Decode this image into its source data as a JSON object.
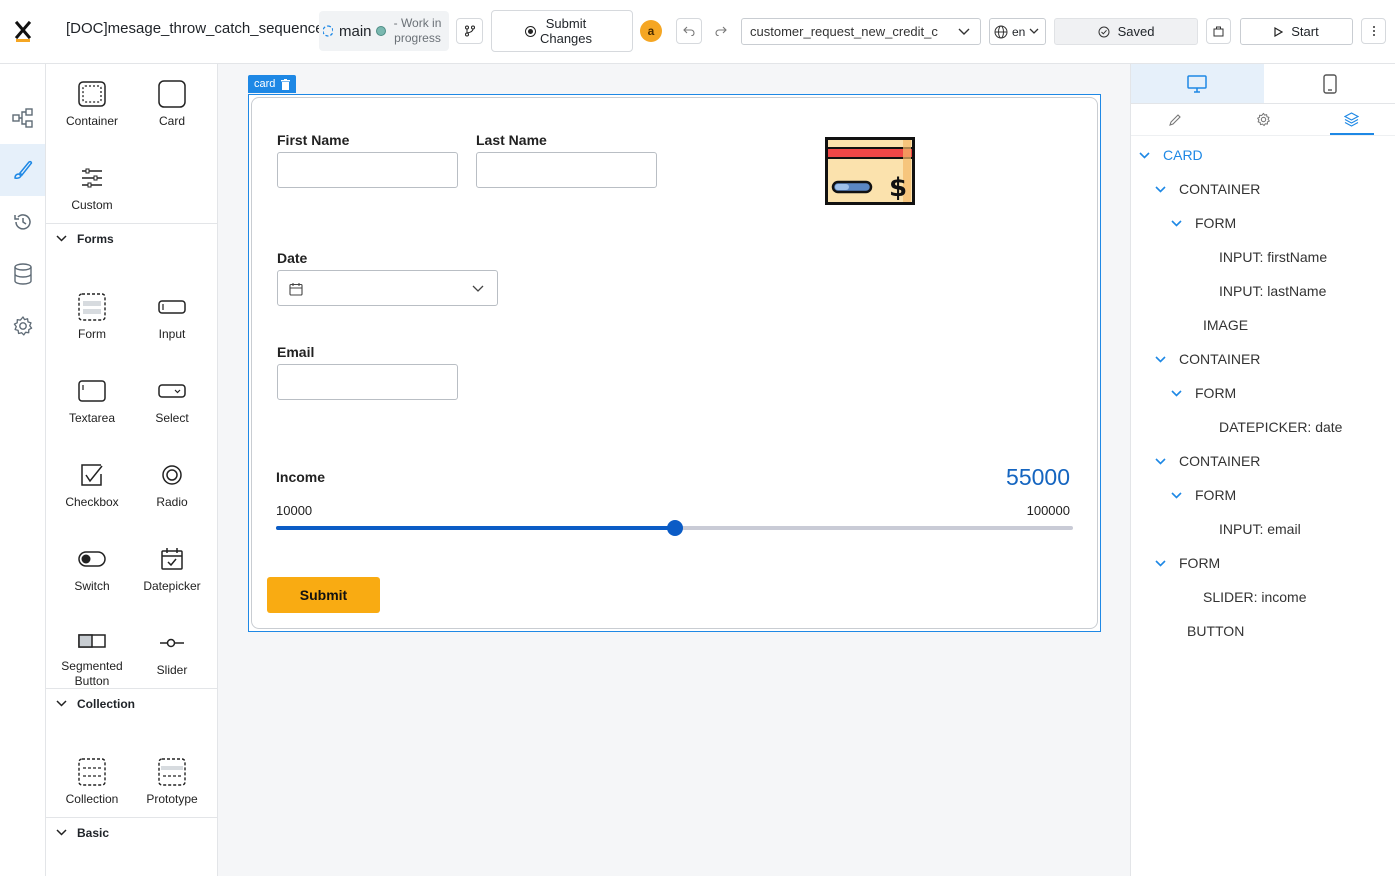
{
  "header": {
    "logo_letter": "x",
    "process_title": "[DOC]mesage_throw_catch_sequence",
    "branch_name": "main",
    "branch_status": "- Work in progress",
    "submit_changes_label": "Submit Changes",
    "user_initial": "a",
    "datasource": "customer_request_new_credit_c",
    "language": "en",
    "saved_label": "Saved",
    "start_label": "Start"
  },
  "rail": {
    "items": [
      "process-icon",
      "brush-icon",
      "history-icon",
      "database-icon",
      "settings-icon"
    ],
    "active": "brush-icon"
  },
  "palette": {
    "top_items": [
      {
        "label": "Container",
        "icon": "container-icon"
      },
      {
        "label": "Card",
        "icon": "card-icon"
      },
      {
        "label": "Custom",
        "icon": "custom-icon"
      }
    ],
    "forms_title": "Forms",
    "forms_items": [
      {
        "label": "Form",
        "icon": "form-icon"
      },
      {
        "label": "Input",
        "icon": "input-icon"
      },
      {
        "label": "Textarea",
        "icon": "textarea-icon"
      },
      {
        "label": "Select",
        "icon": "select-icon"
      },
      {
        "label": "Checkbox",
        "icon": "checkbox-icon"
      },
      {
        "label": "Radio",
        "icon": "radio-icon"
      },
      {
        "label": "Switch",
        "icon": "switch-icon"
      },
      {
        "label": "Datepicker",
        "icon": "datepicker-icon"
      },
      {
        "label": "Segmented Button",
        "icon": "segmented-button-icon"
      },
      {
        "label": "Slider",
        "icon": "slider-icon"
      }
    ],
    "collection_title": "Collection",
    "collection_items": [
      {
        "label": "Collection",
        "icon": "collection-icon"
      },
      {
        "label": "Prototype",
        "icon": "prototype-icon"
      }
    ],
    "basic_title": "Basic"
  },
  "canvas": {
    "card_tag": "card",
    "first_name_label": "First Name",
    "first_name_value": "",
    "last_name_label": "Last Name",
    "last_name_value": "",
    "date_label": "Date",
    "email_label": "Email",
    "email_value": "",
    "income_label": "Income",
    "income_value": "55000",
    "income_min": "10000",
    "income_max": "100000",
    "income_fraction": 0.5,
    "submit_label": "Submit",
    "image_icon": "credit-card-icon",
    "colors": {
      "accent": "#1e88e5",
      "slider": "#0b5cc6",
      "submit": "#f9ab12"
    }
  },
  "right_panel": {
    "device_tabs": [
      "desktop-icon",
      "mobile-icon"
    ],
    "prop_tabs": [
      "pencil-icon",
      "gear-icon",
      "layers-icon"
    ],
    "tree": [
      {
        "label": "CARD",
        "level": 0,
        "expanded": true,
        "selected": true
      },
      {
        "label": "CONTAINER",
        "level": 1,
        "expanded": true
      },
      {
        "label": "FORM",
        "level": 2,
        "expanded": true
      },
      {
        "label": "INPUT: firstName",
        "level": 3,
        "leaf": true
      },
      {
        "label": "INPUT: lastName",
        "level": 3,
        "leaf": true
      },
      {
        "label": "IMAGE",
        "level": 2,
        "leaf": true
      },
      {
        "label": "CONTAINER",
        "level": 1,
        "expanded": true
      },
      {
        "label": "FORM",
        "level": 2,
        "expanded": true
      },
      {
        "label": "DATEPICKER: date",
        "level": 3,
        "leaf": true
      },
      {
        "label": "CONTAINER",
        "level": 1,
        "expanded": true
      },
      {
        "label": "FORM",
        "level": 2,
        "expanded": true
      },
      {
        "label": "INPUT: email",
        "level": 3,
        "leaf": true
      },
      {
        "label": "FORM",
        "level": 1,
        "expanded": true
      },
      {
        "label": "SLIDER: income",
        "level": 2,
        "leaf": true
      },
      {
        "label": "BUTTON",
        "level": 1,
        "leaf": true
      }
    ]
  }
}
